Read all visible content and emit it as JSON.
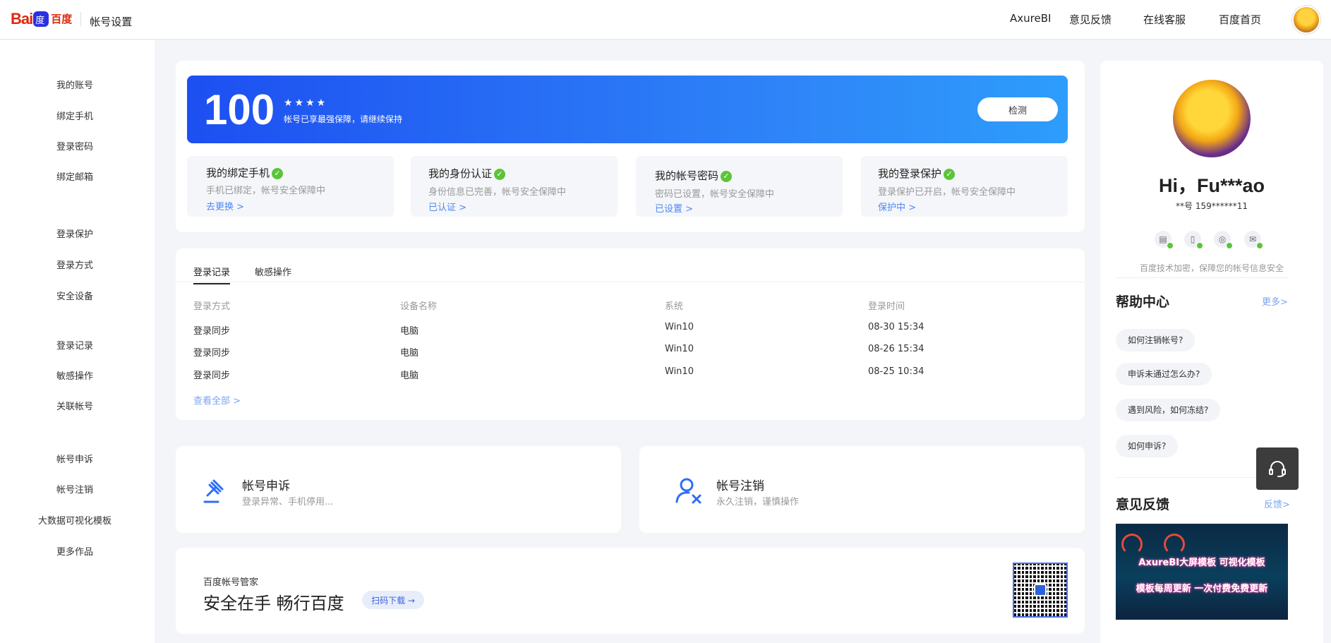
{
  "header": {
    "logo_bai": "Bai",
    "logo_du": "百度",
    "title": "帐号设置",
    "nav": [
      "AxureBI",
      "意见反馈",
      "在线客服",
      "百度首页"
    ]
  },
  "sidebar": {
    "items": [
      "我的账号",
      "绑定手机",
      "登录密码",
      "绑定邮箱",
      "登录保护",
      "登录方式",
      "安全设备",
      "登录记录",
      "敏感操作",
      "关联帐号",
      "帐号申诉",
      "帐号注销",
      "大数据可视化模板",
      "更多作品"
    ]
  },
  "security": {
    "score": "100",
    "stars": "★★★★",
    "message": "帐号已享最强保障，请继续保持",
    "detect_label": "检测"
  },
  "status_cards": [
    {
      "title": "我的绑定手机",
      "desc": "手机已绑定，帐号安全保障中",
      "link": "去更换 >"
    },
    {
      "title": "我的身份认证",
      "desc": "身份信息已完善，帐号安全保障中",
      "link": "已认证 >"
    },
    {
      "title": "我的帐号密码",
      "desc": "密码已设置，帐号安全保障中",
      "link": "已设置 >"
    },
    {
      "title": "我的登录保护",
      "desc": "登录保护已开启，帐号安全保障中",
      "link": "保护中 >"
    }
  ],
  "records": {
    "tabs": [
      "登录记录",
      "敏感操作"
    ],
    "columns": [
      "登录方式",
      "设备名称",
      "系统",
      "登录时间"
    ],
    "rows": [
      [
        "登录同步",
        "电脑",
        "Win10",
        "08-30 15:34"
      ],
      [
        "登录同步",
        "电脑",
        "Win10",
        "08-26 15:34"
      ],
      [
        "登录同步",
        "电脑",
        "Win10",
        "08-25 10:34"
      ]
    ],
    "view_all": "查看全部 >"
  },
  "actions": [
    {
      "title": "帐号申诉",
      "desc": "登录异常、手机停用..."
    },
    {
      "title": "帐号注销",
      "desc": "永久注销，谨慎操作"
    }
  ],
  "promo": {
    "subtitle": "百度帐号管家",
    "title": "安全在手 畅行百度",
    "button": "扫码下载 →"
  },
  "profile": {
    "greeting": "Hi，Fu***ao",
    "account": "**号   159******11",
    "tip": "百度技术加密，保障您的帐号信息安全"
  },
  "help": {
    "title": "帮助中心",
    "more": "更多>",
    "items": [
      "如何注销帐号?",
      "申诉未通过怎么办?",
      "遇到风险，如何冻结?",
      "如何申诉?"
    ]
  },
  "feedback": {
    "title": "意见反馈",
    "more": "反馈>",
    "banner_line1": "AxureBI大屏模板 可视化模板",
    "banner_line2": "模板每周更新 一次付费免费更新"
  },
  "colors": {
    "accent": "#2f6df6",
    "success": "#5cc43a",
    "link": "#4e88f5"
  }
}
